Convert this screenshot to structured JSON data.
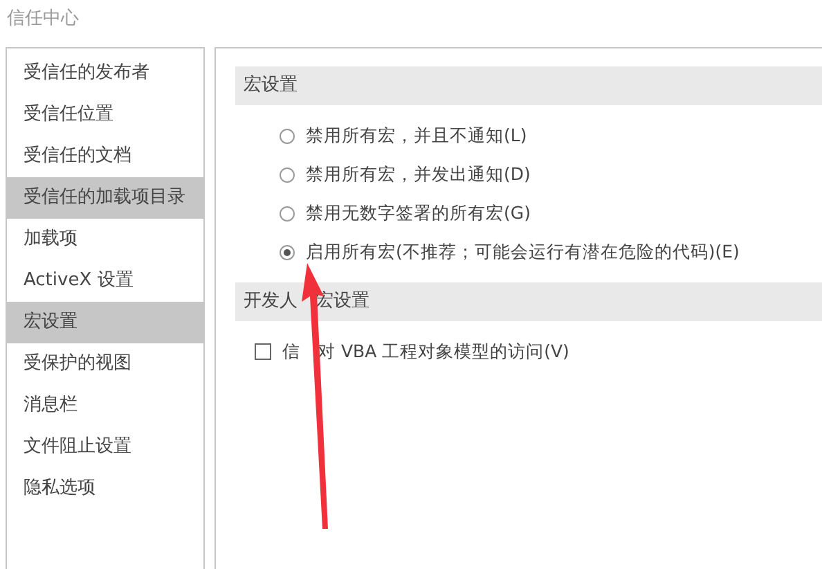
{
  "window": {
    "title": "信任中心"
  },
  "sidebar": {
    "items": [
      {
        "label": "受信任的发布者",
        "selected": false
      },
      {
        "label": "受信任位置",
        "selected": false
      },
      {
        "label": "受信任的文档",
        "selected": false
      },
      {
        "label": "受信任的加载项目录",
        "selected": true
      },
      {
        "label": "加载项",
        "selected": false
      },
      {
        "label": "ActiveX 设置",
        "selected": false
      },
      {
        "label": "宏设置",
        "selected": true
      },
      {
        "label": "受保护的视图",
        "selected": false
      },
      {
        "label": "消息栏",
        "selected": false
      },
      {
        "label": "文件阻止设置",
        "selected": false
      },
      {
        "label": "隐私选项",
        "selected": false
      }
    ]
  },
  "macro_settings": {
    "heading": "宏设置",
    "options": [
      {
        "label": "禁用所有宏，并且不通知(L)",
        "selected": false
      },
      {
        "label": "禁用所有宏，并发出通知(D)",
        "selected": false
      },
      {
        "label": "禁用无数字签署的所有宏(G)",
        "selected": false
      },
      {
        "label": "启用所有宏(不推荐；可能会运行有潜在危险的代码)(E)",
        "selected": true
      }
    ]
  },
  "developer_settings": {
    "heading_parts": [
      "开发人",
      "宏设置"
    ],
    "options": [
      {
        "label_parts": [
          "信",
          "对 VBA 工程对象模型的访问(V)"
        ],
        "checked": false
      }
    ]
  }
}
